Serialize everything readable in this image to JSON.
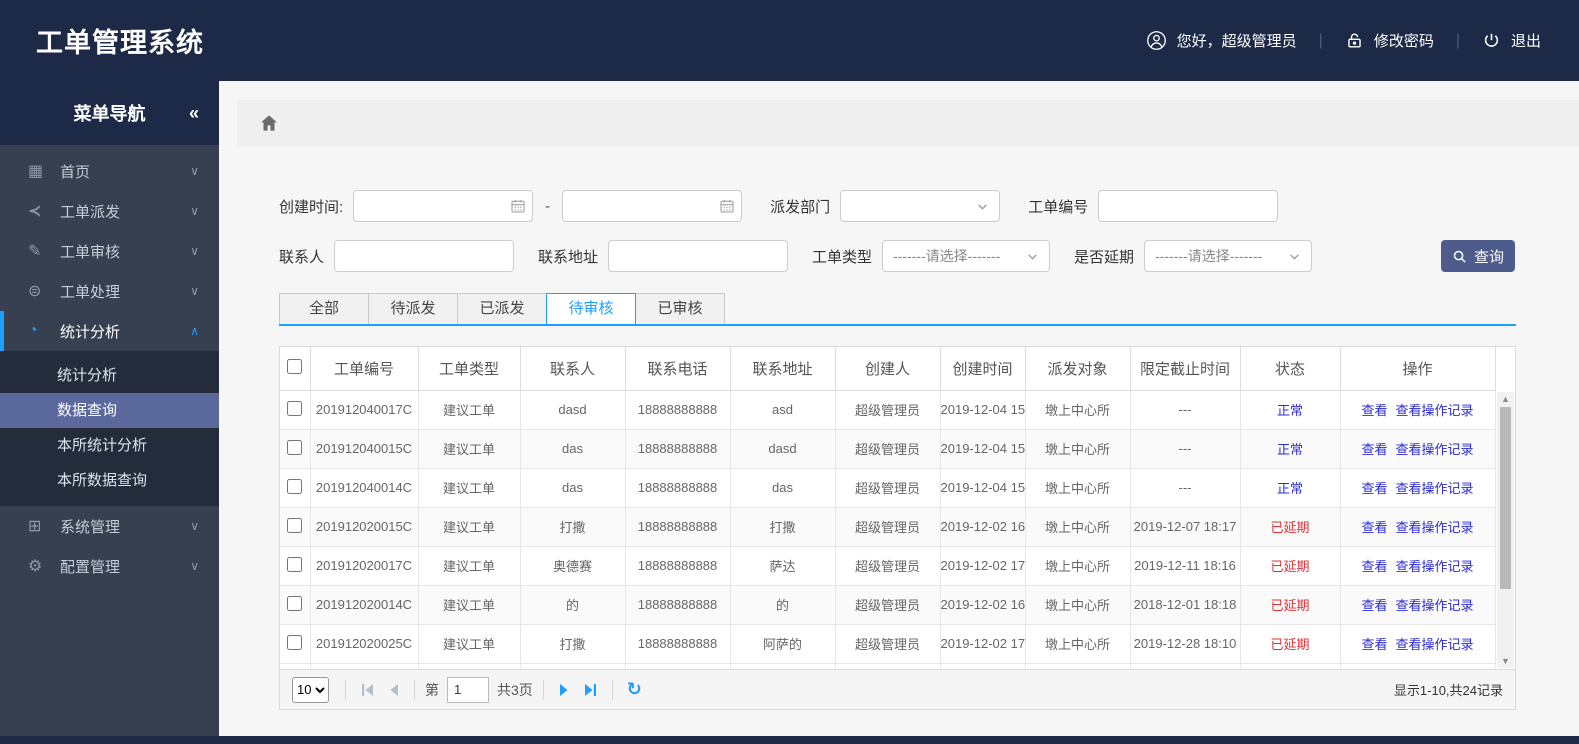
{
  "app": {
    "title": "工单管理系统"
  },
  "header": {
    "greeting": "您好，超级管理员",
    "change_password": "修改密码",
    "logout": "退出"
  },
  "sidebar": {
    "title": "菜单导航",
    "collapse_icon": "«",
    "top_items": [
      {
        "label": "首页",
        "icon": "home-grid-icon",
        "chev": "down",
        "cls": ""
      },
      {
        "label": "工单派发",
        "icon": "share-icon",
        "chev": "down",
        "cls": ""
      },
      {
        "label": "工单审核",
        "icon": "edit-icon",
        "chev": "down",
        "cls": ""
      },
      {
        "label": "工单处理",
        "icon": "process-icon",
        "chev": "down",
        "cls": ""
      },
      {
        "label": "统计分析",
        "icon": "pie-chart-icon",
        "chev": "up",
        "cls": "active"
      }
    ],
    "submenu_items": [
      {
        "label": "统计分析",
        "cls": ""
      },
      {
        "label": "数据查询",
        "cls": "selected"
      },
      {
        "label": "本所统计分析",
        "cls": ""
      },
      {
        "label": "本所数据查询",
        "cls": ""
      }
    ],
    "bottom_items": [
      {
        "label": "系统管理",
        "icon": "modules-icon",
        "chev": "down",
        "cls": ""
      },
      {
        "label": "配置管理",
        "icon": "gear-icon",
        "chev": "down",
        "cls": ""
      }
    ]
  },
  "filters": {
    "create_time_label": "创建时间:",
    "range_separator": "-",
    "dispatch_dept_label": "派发部门",
    "order_no_label": "工单编号",
    "contact_label": "联系人",
    "address_label": "联系地址",
    "order_type_label": "工单类型",
    "order_type_value": "-------请选择-------",
    "delay_label": "是否延期",
    "delay_value": "-------请选择-------",
    "search_button": "查询"
  },
  "tabs": {
    "items": [
      {
        "label": "全部",
        "cls": ""
      },
      {
        "label": "待派发",
        "cls": ""
      },
      {
        "label": "已派发",
        "cls": ""
      },
      {
        "label": "待审核",
        "cls": "active"
      },
      {
        "label": "已审核",
        "cls": ""
      }
    ]
  },
  "table": {
    "columns": [
      "工单编号",
      "工单类型",
      "联系人",
      "联系电话",
      "联系地址",
      "创建人",
      "创建时间",
      "派发对象",
      "限定截止时间",
      "状态",
      "操作"
    ],
    "view_label": "查看",
    "view_log_label": "查看操作记录",
    "rows": [
      {
        "order_no": "201912040017C",
        "type": "建议工单",
        "contact": "dasd",
        "phone": "18888888888",
        "address": "asd",
        "creator": "超级管理员",
        "created": "2019-12-04 15",
        "target": "墩上中心所",
        "deadline": "---",
        "status": "正常",
        "status_cls": "status-normal"
      },
      {
        "order_no": "201912040015C",
        "type": "建议工单",
        "contact": "das",
        "phone": "18888888888",
        "address": "dasd",
        "creator": "超级管理员",
        "created": "2019-12-04 15",
        "target": "墩上中心所",
        "deadline": "---",
        "status": "正常",
        "status_cls": "status-normal"
      },
      {
        "order_no": "201912040014C",
        "type": "建议工单",
        "contact": "das",
        "phone": "18888888888",
        "address": "das",
        "creator": "超级管理员",
        "created": "2019-12-04 15",
        "target": "墩上中心所",
        "deadline": "---",
        "status": "正常",
        "status_cls": "status-normal"
      },
      {
        "order_no": "201912020015C",
        "type": "建议工单",
        "contact": "打撒",
        "phone": "18888888888",
        "address": "打撒",
        "creator": "超级管理员",
        "created": "2019-12-02 16",
        "target": "墩上中心所",
        "deadline": "2019-12-07 18:17",
        "status": "已延期",
        "status_cls": "status-delayed"
      },
      {
        "order_no": "201912020017C",
        "type": "建议工单",
        "contact": "奥德赛",
        "phone": "18888888888",
        "address": "萨达",
        "creator": "超级管理员",
        "created": "2019-12-02 17",
        "target": "墩上中心所",
        "deadline": "2019-12-11 18:16",
        "status": "已延期",
        "status_cls": "status-delayed"
      },
      {
        "order_no": "201912020014C",
        "type": "建议工单",
        "contact": "的",
        "phone": "18888888888",
        "address": "的",
        "creator": "超级管理员",
        "created": "2019-12-02 16",
        "target": "墩上中心所",
        "deadline": "2018-12-01 18:18",
        "status": "已延期",
        "status_cls": "status-delayed"
      },
      {
        "order_no": "201912020025C",
        "type": "建议工单",
        "contact": "打撒",
        "phone": "18888888888",
        "address": "阿萨的",
        "creator": "超级管理员",
        "created": "2019-12-02 17",
        "target": "墩上中心所",
        "deadline": "2019-12-28 18:10",
        "status": "已延期",
        "status_cls": "status-delayed"
      }
    ]
  },
  "pagination": {
    "page_size": "10",
    "page_prefix": "第",
    "current_page": "1",
    "total_pages": "共3页",
    "summary": "显示1-10,共24记录"
  },
  "colors": {
    "accent_blue": "#1E9FFF",
    "header_navy": "#1c2a48",
    "sidebar_bg": "#364050",
    "submenu_selected": "#5a689b",
    "button_bg": "#4d5c8c",
    "status_normal": "#2b2bd8",
    "status_delayed": "#e03236"
  }
}
